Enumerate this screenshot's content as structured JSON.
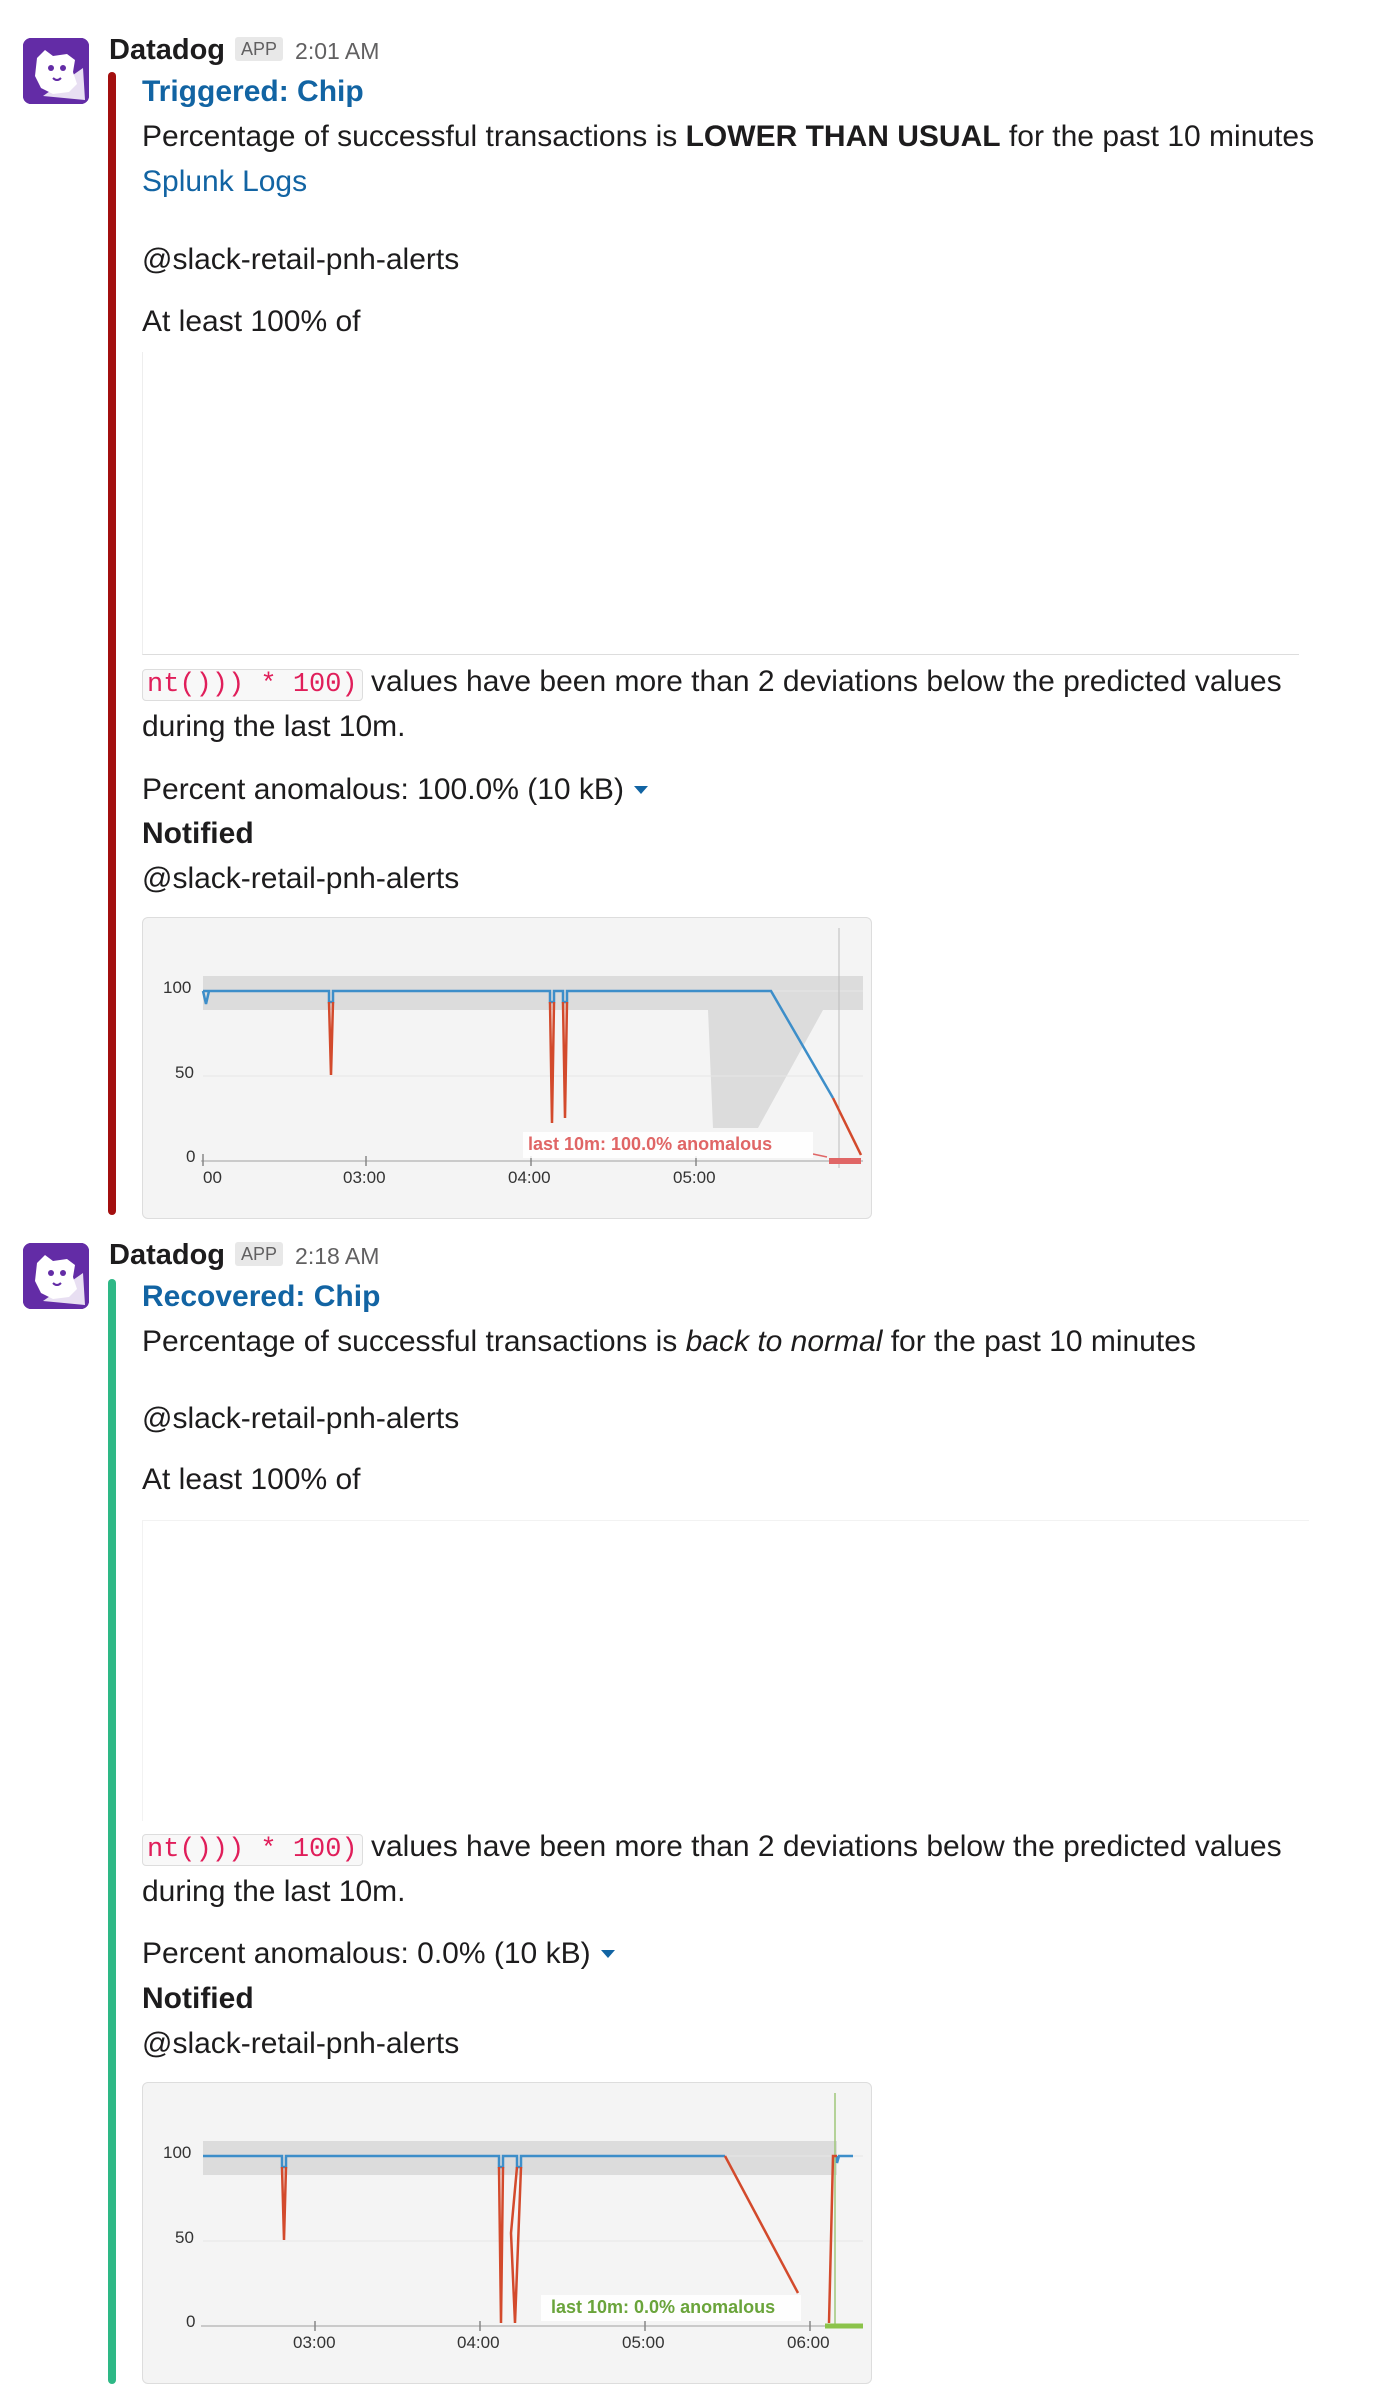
{
  "messages": [
    {
      "sender": "Datadog",
      "badge": "APP",
      "time": "2:01 AM",
      "status_color": "#a30f0f",
      "title": "Triggered: Chip",
      "text_prefix": "Percentage of successful transactions is ",
      "text_emph": "LOWER THAN USUAL",
      "text_suffix": " for the past 10 minutes",
      "link": "Splunk Logs",
      "mention": "@slack-retail-pnh-alerts",
      "at_least": "At least 100% of",
      "code": "nt())) * 100)",
      "deviation_text": " values have been more than 2 deviations below the predicted values",
      "deviation_text2": "during the last 10m.",
      "percent": "Percent anomalous: 100.0% (10 kB)",
      "notified_label": "Notified",
      "notified_mention": "@slack-retail-pnh-alerts",
      "chart": {
        "y_ticks": [
          "100",
          "50",
          "0"
        ],
        "x_ticks": [
          "00",
          "03:00",
          "04:00",
          "05:00"
        ],
        "annotation": "last 10m: 100.0% anomalous",
        "annotation_color": "#e06666",
        "metric_color": "#3d8ec9",
        "anomaly_color": "#d34a2c",
        "band_color": "#d9d9d9"
      }
    },
    {
      "sender": "Datadog",
      "badge": "APP",
      "time": "2:18 AM",
      "status_color": "#2eb886",
      "title": "Recovered: Chip",
      "text_prefix": "Percentage of successful transactions is ",
      "text_emph": "back to normal",
      "text_suffix": " for the past 10 minutes",
      "mention": "@slack-retail-pnh-alerts",
      "at_least": "At least 100% of",
      "code": "nt())) * 100)",
      "deviation_text": " values have been more than 2 deviations below the predicted values",
      "deviation_text2": "during the last 10m.",
      "percent": "Percent anomalous: 0.0% (10 kB)",
      "notified_label": "Notified",
      "notified_mention": "@slack-retail-pnh-alerts",
      "chart": {
        "y_ticks": [
          "100",
          "50",
          "0"
        ],
        "x_ticks": [
          "03:00",
          "04:00",
          "05:00",
          "06:00"
        ],
        "annotation": "last 10m: 0.0% anomalous",
        "annotation_color": "#6aa43b",
        "metric_color": "#3d8ec9",
        "anomaly_color": "#d34a2c",
        "band_color": "#d9d9d9"
      }
    }
  ]
}
